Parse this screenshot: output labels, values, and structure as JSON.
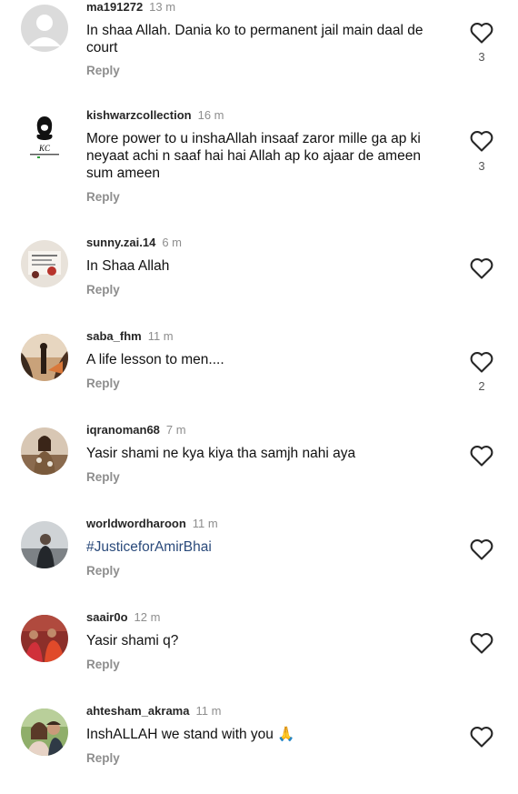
{
  "comments": [
    {
      "username": "ma191272",
      "time": "13 m",
      "text": "In shaa Allah.  Dania ko to permanent  jail main  daal de court",
      "reply": "Reply",
      "likes": "3",
      "avatar": "default-avatar"
    },
    {
      "username": "kishwarzcollection",
      "time": "16 m",
      "text": "More power to u inshaAllah insaaf zaror mille ga ap ki neyaat achi n saaf hai hai Allah ap ko ajaar de ameen sum ameen",
      "reply": "Reply",
      "likes": "3",
      "avatar": "kc-logo-avatar"
    },
    {
      "username": "sunny.zai.14",
      "time": "6 m",
      "text": "In Shaa Allah",
      "reply": "Reply",
      "likes": "",
      "avatar": "photo-avatar"
    },
    {
      "username": "saba_fhm",
      "time": "11 m",
      "text": "A life lesson to men....",
      "reply": "Reply",
      "likes": "2",
      "avatar": "photo-avatar"
    },
    {
      "username": "iqranoman68",
      "time": "7 m",
      "text": "Yasir shami ne kya kiya tha samjh nahi aya",
      "reply": "Reply",
      "likes": "",
      "avatar": "photo-avatar"
    },
    {
      "username": "worldwordharoon",
      "time": "11 m",
      "text": "#JusticeforAmirBhai",
      "reply": "Reply",
      "likes": "",
      "avatar": "photo-avatar",
      "hashtag": true
    },
    {
      "username": "saair0o",
      "time": "12 m",
      "text": "Yasir shami q?",
      "reply": "Reply",
      "likes": "",
      "avatar": "photo-avatar"
    },
    {
      "username": "ahtesham_akrama",
      "time": "11 m",
      "text": "InshALLAH we stand with you 🙏",
      "reply": "Reply",
      "likes": "",
      "avatar": "photo-avatar"
    }
  ],
  "kc_logo_text": "KC",
  "colors": {
    "hashtag": "#2a4a7b",
    "muted": "#8e8e8e"
  }
}
